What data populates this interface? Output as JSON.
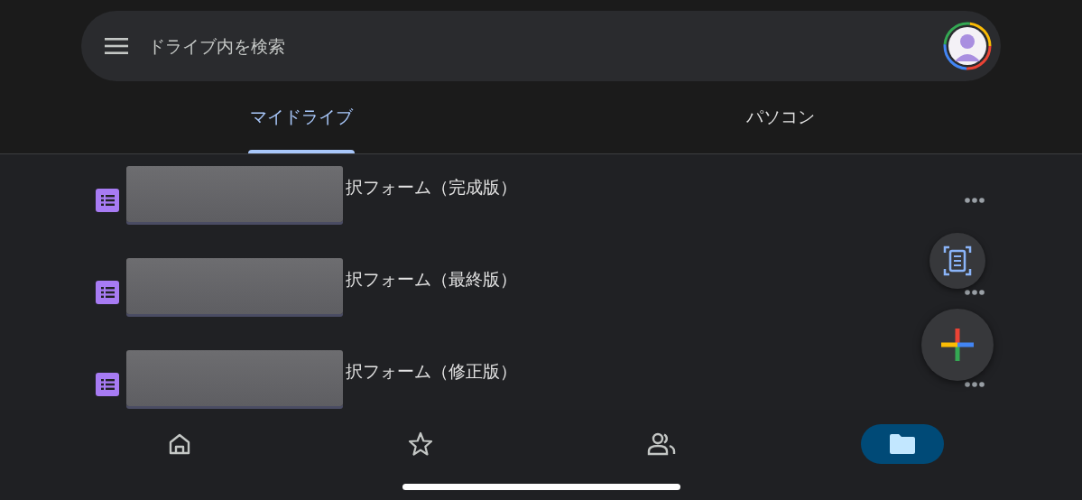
{
  "search": {
    "placeholder": "ドライブ内を検索"
  },
  "tabs": [
    {
      "label": "マイドライブ",
      "selected": true
    },
    {
      "label": "パソコン",
      "selected": false
    }
  ],
  "files": [
    {
      "name": "択フォーム（完成版）",
      "kind": "form"
    },
    {
      "name": "択フォーム（最終版）",
      "kind": "form"
    },
    {
      "name": "択フォーム（修正版）",
      "kind": "form"
    }
  ],
  "bottom_nav": [
    {
      "kind": "home",
      "selected": false
    },
    {
      "kind": "starred",
      "selected": false
    },
    {
      "kind": "shared",
      "selected": false
    },
    {
      "kind": "files",
      "selected": true
    }
  ]
}
